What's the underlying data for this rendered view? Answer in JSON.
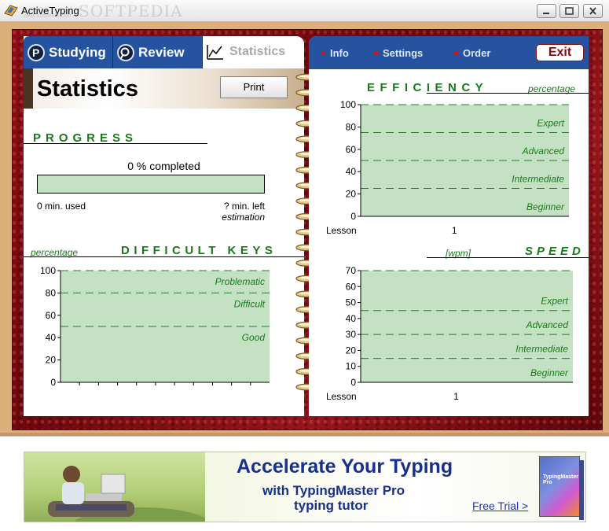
{
  "window": {
    "title": "ActiveTyping",
    "watermark": "SOFTPEDIA",
    "watermark_url": "www.softpedia.com"
  },
  "tabs": [
    {
      "label": "Studying",
      "icon": "studying-icon",
      "active": false
    },
    {
      "label": "Review",
      "icon": "review-icon",
      "active": false
    },
    {
      "label": "Statistics",
      "icon": "chart-icon",
      "active": true
    }
  ],
  "left_page": {
    "title": "Statistics",
    "print_label": "Print",
    "progress": {
      "title": "PROGRESS",
      "completed_text": "0 % completed",
      "value_percent": 0,
      "used_text": "0 min. used",
      "left_text": "? min. left",
      "estimation_text": "estimation"
    }
  },
  "right_page": {
    "menu": [
      "Info",
      "Settings",
      "Order"
    ],
    "exit_label": "Exit"
  },
  "colors": {
    "accent_blue": "#2553a0",
    "chart_fill": "#c4e1c4",
    "label_green": "#1a7a1a",
    "cover_red": "#8e0f16"
  },
  "chart_data": [
    {
      "type": "bar",
      "title": "EFFICIENCY",
      "unit_label": "percentage",
      "xlabel": "Lesson",
      "x_ticks": [
        "1"
      ],
      "ylim": [
        0,
        100
      ],
      "y_ticks": [
        0,
        20,
        40,
        60,
        80,
        100
      ],
      "bands": [
        {
          "label": "Beginner",
          "from": 0,
          "to": 25
        },
        {
          "label": "Intermediate",
          "from": 25,
          "to": 50
        },
        {
          "label": "Advanced",
          "from": 50,
          "to": 75
        },
        {
          "label": "Expert",
          "from": 75,
          "to": 100
        }
      ],
      "values": []
    },
    {
      "type": "bar",
      "title": "DIFFICULT KEYS",
      "unit_label": "percentage",
      "ylim": [
        0,
        100
      ],
      "y_ticks": [
        0,
        20,
        40,
        60,
        80,
        100
      ],
      "bands": [
        {
          "label": "Good",
          "from": 0,
          "to": 50
        },
        {
          "label": "Difficult",
          "from": 50,
          "to": 80
        },
        {
          "label": "Problematic",
          "from": 80,
          "to": 100
        }
      ],
      "values": []
    },
    {
      "type": "bar",
      "title": "SPEED",
      "unit_label": "[wpm]",
      "xlabel": "Lesson",
      "x_ticks": [
        "1"
      ],
      "ylim": [
        0,
        70
      ],
      "y_ticks": [
        0,
        10,
        20,
        30,
        40,
        50,
        60,
        70
      ],
      "bands": [
        {
          "label": "Beginner",
          "from": 0,
          "to": 15
        },
        {
          "label": "Intermediate",
          "from": 15,
          "to": 30
        },
        {
          "label": "Advanced",
          "from": 30,
          "to": 45
        },
        {
          "label": "Expert",
          "from": 45,
          "to": 70
        }
      ],
      "values": []
    }
  ],
  "banner": {
    "title": "Accelerate Your Typing",
    "line1": "with TypingMaster Pro",
    "line2": "typing tutor",
    "cta": "Free Trial >",
    "box_label": "TypingMaster Pro"
  }
}
